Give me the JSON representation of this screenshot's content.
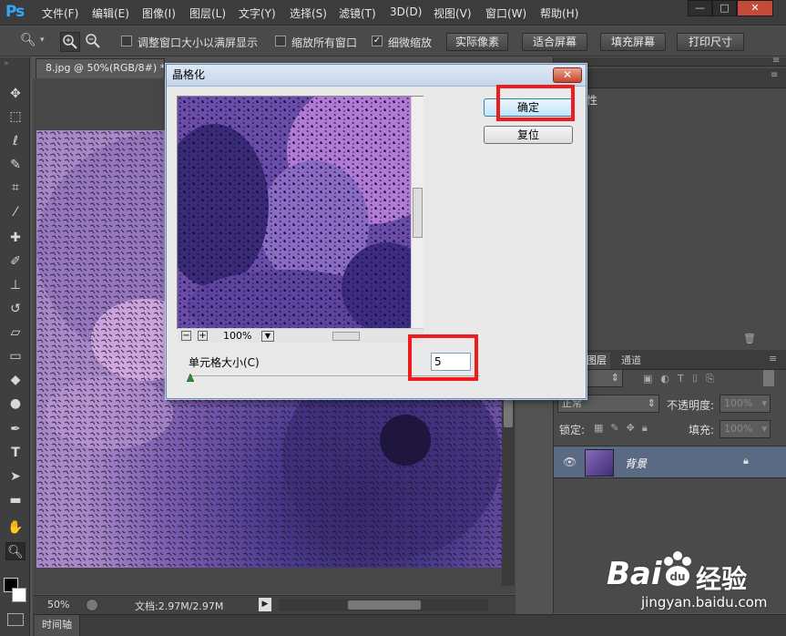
{
  "app": {
    "logo": "Ps",
    "menu": [
      "文件(F)",
      "编辑(E)",
      "图像(I)",
      "图层(L)",
      "文字(Y)",
      "选择(S)",
      "滤镜(T)",
      "3D(D)",
      "视图(V)",
      "窗口(W)",
      "帮助(H)"
    ],
    "window_buttons": [
      "—",
      "□",
      "✕"
    ]
  },
  "options_bar": {
    "checkbox1_label": "调整窗口大小以满屏显示",
    "checkbox1_checked": false,
    "checkbox2_label": "缩放所有窗口",
    "checkbox2_checked": false,
    "checkbox3_label": "细微缩放",
    "checkbox3_checked": true,
    "btn_actual_pixels": "实际像素",
    "btn_fit_screen": "适合屏幕",
    "btn_fill_screen": "填充屏幕",
    "btn_print_size": "打印尺寸"
  },
  "document": {
    "tab_title": "8.jpg @ 50%(RGB/8#) *",
    "zoom": "50%",
    "doc_info": "文档:2.97M/2.97M"
  },
  "timeline_label": "时间轴",
  "dialog": {
    "title": "晶格化",
    "close": "✕",
    "ok_label": "确定",
    "reset_label": "复位",
    "preview_zoom": "100%",
    "cell_size_label": "单元格大小(C)",
    "cell_size_value": "5",
    "zoom_out": "−",
    "zoom_in": "+"
  },
  "right_panel": {
    "prop_fragment": "性",
    "layers_tab": "图层",
    "channels_tab": "通道",
    "kind_label": "类型",
    "blend_mode": "正常",
    "opacity_label": "不透明度:",
    "opacity_value": "100%",
    "lock_label": "锁定:",
    "fill_label": "填充:",
    "fill_value": "100%",
    "layer_name": "背景"
  },
  "watermark": {
    "brand": "Bai",
    "brand2": "du",
    "cn": "经验",
    "url": "jingyan.baidu.com"
  }
}
